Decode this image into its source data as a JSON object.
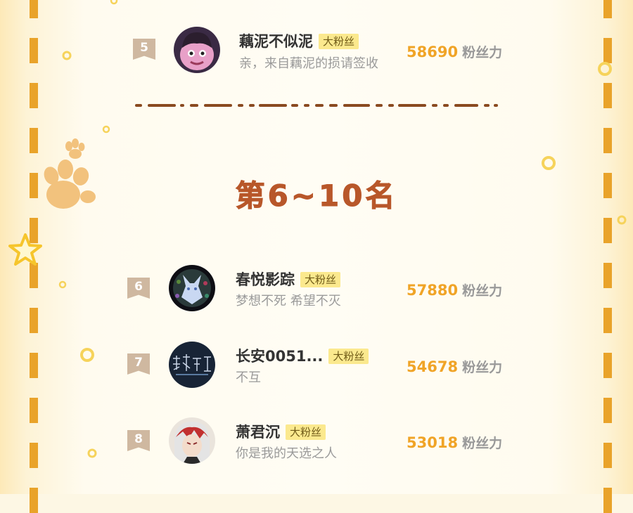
{
  "section": {
    "heading": "第6~10名"
  },
  "entries": [
    {
      "rank": "5",
      "name": "藕泥不似泥",
      "tag": "大粉丝",
      "signature": "亲，来自藕泥的损请签收",
      "score": "58690",
      "unit": "粉丝力"
    },
    {
      "rank": "6",
      "name": "春悦影踪",
      "tag": "大粉丝",
      "signature": "梦想不死 希望不灭",
      "score": "57880",
      "unit": "粉丝力"
    },
    {
      "rank": "7",
      "name": "长安0051...",
      "tag": "大粉丝",
      "signature": "不互",
      "score": "54678",
      "unit": "粉丝力"
    },
    {
      "rank": "8",
      "name": "萧君沉",
      "tag": "大粉丝",
      "signature": "你是我的天选之人",
      "score": "53018",
      "unit": "粉丝力"
    }
  ],
  "colors": {
    "accent": "#f0a427",
    "tag_bg": "#fbe98e",
    "heading": "#b8572a",
    "border_dash": "#e9a32a"
  },
  "icons": [
    "paw-icon",
    "star-icon",
    "dot-ring-icon"
  ]
}
